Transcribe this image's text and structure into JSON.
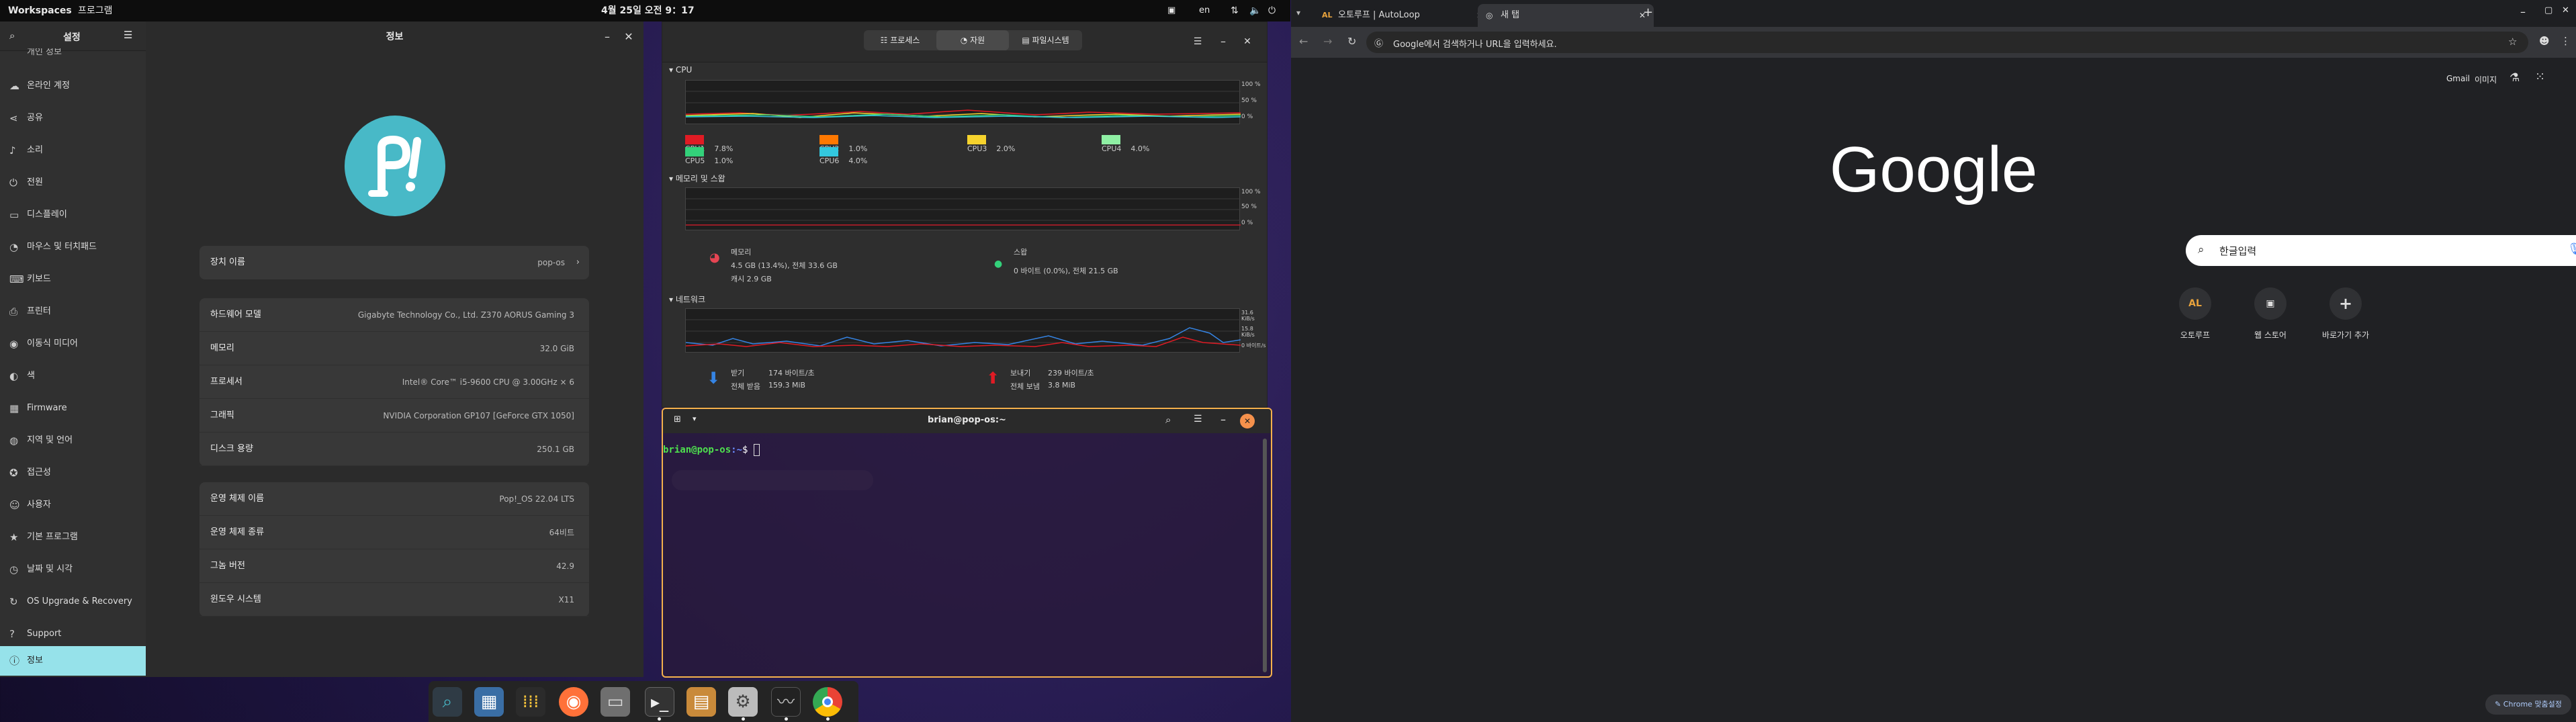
{
  "topbar": {
    "workspaces": "Workspaces",
    "programs": "프로그램",
    "datetime": "4월 25일 오전 9：17",
    "lang": "en"
  },
  "settings": {
    "sidebar_title": "설정",
    "items": [
      {
        "icon": "cloud-icon",
        "glyph": "☁",
        "label": "온라인 계정"
      },
      {
        "icon": "share-icon",
        "glyph": "⋖",
        "label": "공유"
      },
      {
        "icon": "sound-icon",
        "glyph": "♪",
        "label": "소리"
      },
      {
        "icon": "power-icon",
        "glyph": "⏻",
        "label": "전원"
      },
      {
        "icon": "display-icon",
        "glyph": "▭",
        "label": "디스플레이"
      },
      {
        "icon": "mouse-icon",
        "glyph": "◔",
        "label": "마우스 및 터치패드"
      },
      {
        "icon": "keyboard-icon",
        "glyph": "⌨",
        "label": "키보드"
      },
      {
        "icon": "printer-icon",
        "glyph": "⎙",
        "label": "프린터"
      },
      {
        "icon": "media-icon",
        "glyph": "◉",
        "label": "이동식 미디어"
      },
      {
        "icon": "color-icon",
        "glyph": "◐",
        "label": "색"
      },
      {
        "icon": "firmware-icon",
        "glyph": "▦",
        "label": "Firmware"
      },
      {
        "icon": "region-icon",
        "glyph": "◍",
        "label": "지역 및 언어"
      },
      {
        "icon": "accessibility-icon",
        "glyph": "✪",
        "label": "접근성"
      },
      {
        "icon": "users-icon",
        "glyph": "☺",
        "label": "사용자"
      },
      {
        "icon": "star-icon",
        "glyph": "★",
        "label": "기본 프로그램"
      },
      {
        "icon": "clock-icon",
        "glyph": "◷",
        "label": "날짜 및 시각"
      },
      {
        "icon": "upgrade-icon",
        "glyph": "↻",
        "label": "OS Upgrade & Recovery"
      },
      {
        "icon": "support-icon",
        "glyph": "?",
        "label": "Support"
      },
      {
        "icon": "info-icon",
        "glyph": "ⓘ",
        "label": "정보"
      }
    ],
    "cut_item": "개인 정보",
    "title": "정보",
    "device_name_label": "장치 이름",
    "device_name": "pop-os",
    "hw": [
      {
        "k": "하드웨어 모델",
        "v": "Gigabyte Technology Co., Ltd. Z370 AORUS Gaming 3"
      },
      {
        "k": "메모리",
        "v": "32.0 GiB"
      },
      {
        "k": "프로세서",
        "v": "Intel® Core™ i5-9600 CPU @ 3.00GHz × 6"
      },
      {
        "k": "그래픽",
        "v": "NVIDIA Corporation GP107 [GeForce GTX 1050]"
      },
      {
        "k": "디스크 용량",
        "v": "250.1 GB"
      }
    ],
    "os": [
      {
        "k": "운영 체제 이름",
        "v": "Pop!_OS 22.04 LTS"
      },
      {
        "k": "운영 체제 종류",
        "v": "64비트"
      },
      {
        "k": "그놈 버전",
        "v": "42.9"
      },
      {
        "k": "윈도우 시스템",
        "v": "X11"
      }
    ]
  },
  "sysmon": {
    "tabs": [
      "프로세스",
      "자원",
      "파일시스템"
    ],
    "cpu_title": "CPU",
    "mem_title": "메모리 및 스왑",
    "net_title": "네트워크",
    "pct": [
      "100 %",
      "50 %",
      "0 %"
    ],
    "net_ticks": [
      "31.6 KiB/s",
      "15.8 KiB/s",
      "0 바이트/s"
    ],
    "cpus": [
      {
        "name": "CPU1",
        "val": "7.8%",
        "color": "#e01b24"
      },
      {
        "name": "CPU2",
        "val": "1.0%",
        "color": "#ff7800"
      },
      {
        "name": "CPU3",
        "val": "2.0%",
        "color": "#f6d32d"
      },
      {
        "name": "CPU4",
        "val": "4.0%",
        "color": "#8ff0a4"
      },
      {
        "name": "CPU5",
        "val": "1.0%",
        "color": "#33d17a"
      },
      {
        "name": "CPU6",
        "val": "4.0%",
        "color": "#33c7de"
      }
    ],
    "mem_label": "메모리",
    "mem_line1": "4.5 GB (13.4%), 전체 33.6 GB",
    "mem_line2": "캐시 2.9 GB",
    "swap_label": "스왑",
    "swap_line": "0 바이트 (0.0%), 전체 21.5 GB",
    "recv_label": "받기",
    "recv_rate": "174 바이트/초",
    "recv_total_label": "전체 받음",
    "recv_total": "159.3 MiB",
    "send_label": "보내기",
    "send_rate": "239 바이트/초",
    "send_total_label": "전체 보냄",
    "send_total": "3.8 MiB"
  },
  "terminal": {
    "title": "brian@pop-os:~",
    "user": "brian@pop-os",
    "path": ":~",
    "prompt": "$"
  },
  "chrome": {
    "tab1": "오토루프 | AutoLoop",
    "tab2": "새 탭",
    "address_placeholder": "Google에서 검색하거나 URL을 입력하세요.",
    "gmail": "Gmail",
    "images": "이미지",
    "logo": "Google",
    "search_value": "한글입력",
    "shortcuts": [
      {
        "label": "오토루프",
        "glyph": "AL"
      },
      {
        "label": "웹 스토어",
        "glyph": "▣"
      },
      {
        "label": "바로가기 추가",
        "glyph": "+"
      }
    ],
    "customize": "Chrome 맞춤설정"
  }
}
